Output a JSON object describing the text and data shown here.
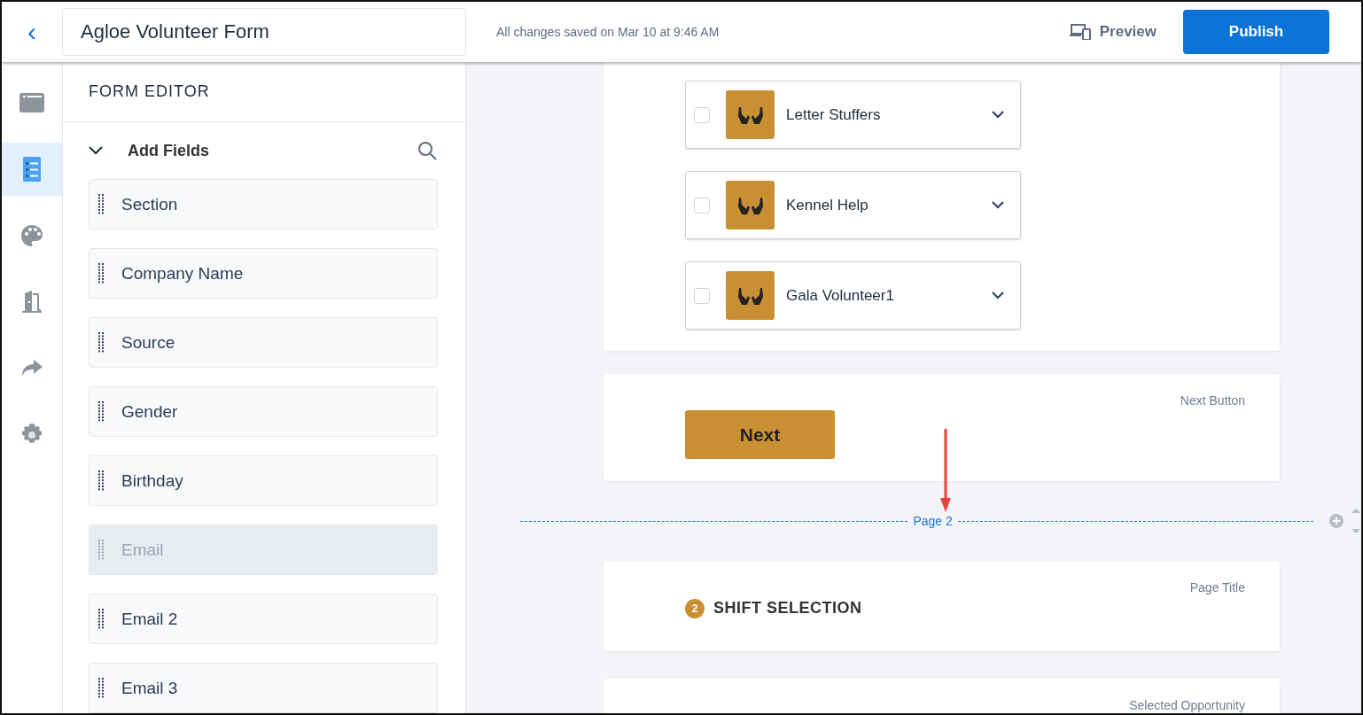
{
  "header": {
    "back": "‹",
    "form_title": "Agloe Volunteer Form",
    "save_status": "All changes saved on Mar 10 at 9:46 AM",
    "preview": "Preview",
    "publish": "Publish"
  },
  "rail": [
    {
      "selected": false
    },
    {
      "selected": true
    },
    {
      "selected": false
    },
    {
      "selected": false
    },
    {
      "selected": false
    },
    {
      "selected": false
    }
  ],
  "sidebar": {
    "title": "FORM EDITOR",
    "section": {
      "label": "Add Fields",
      "expanded": true
    },
    "fields": [
      {
        "label": "Section",
        "disabled": false
      },
      {
        "label": "Company Name",
        "disabled": false
      },
      {
        "label": "Source",
        "disabled": false
      },
      {
        "label": "Gender",
        "disabled": false
      },
      {
        "label": "Birthday",
        "disabled": false
      },
      {
        "label": "Email",
        "disabled": true
      },
      {
        "label": "Email 2",
        "disabled": false
      },
      {
        "label": "Email 3",
        "disabled": false
      }
    ]
  },
  "canvas": {
    "opportunities": [
      {
        "name": "Letter Stuffers",
        "checked": false
      },
      {
        "name": "Kennel Help",
        "checked": false
      },
      {
        "name": "Gala Volunteer1",
        "checked": false
      }
    ],
    "next_block": {
      "tag": "Next Button",
      "button": "Next"
    },
    "page_break": "Page 2",
    "page_title_block": {
      "tag": "Page Title",
      "number": "2",
      "title": "SHIFT SELECTION"
    },
    "selected_block": {
      "tag": "Selected Opportunity"
    }
  }
}
